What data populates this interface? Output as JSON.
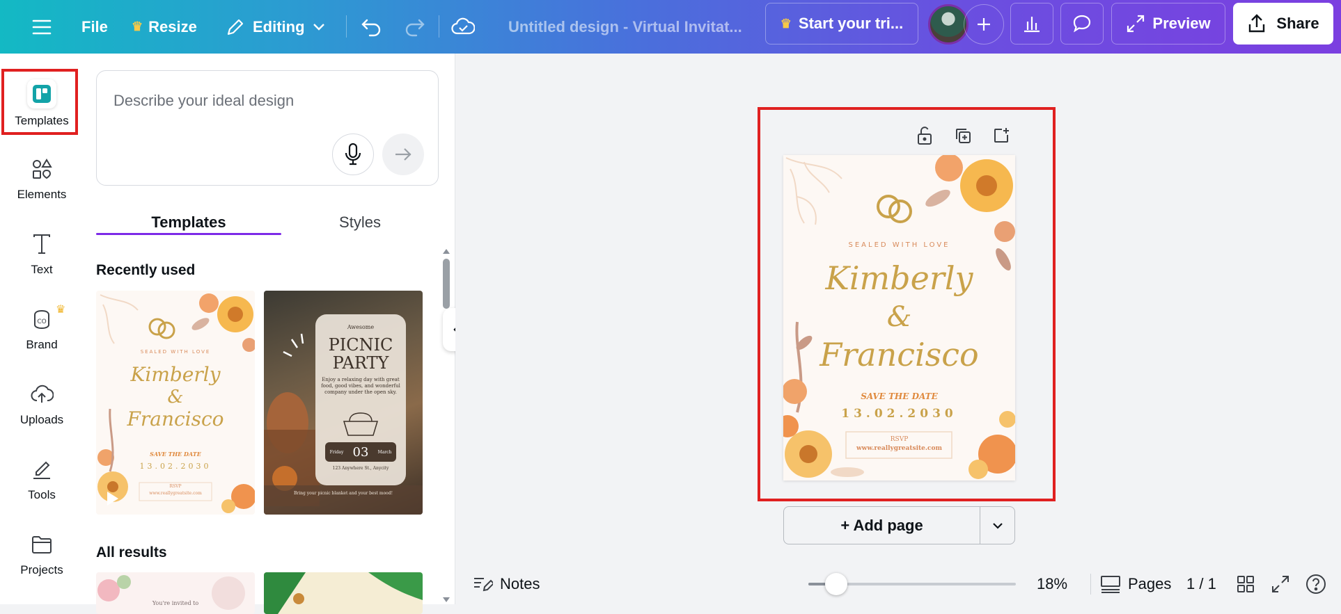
{
  "topbar": {
    "file_label": "File",
    "resize_label": "Resize",
    "editing_label": "Editing",
    "title": "Untitled design - Virtual Invitat...",
    "trial_label": "Start your tri...",
    "preview_label": "Preview",
    "share_label": "Share"
  },
  "rail": {
    "items": [
      {
        "label": "Templates",
        "icon": "templates-icon"
      },
      {
        "label": "Elements",
        "icon": "elements-icon"
      },
      {
        "label": "Text",
        "icon": "text-icon"
      },
      {
        "label": "Brand",
        "icon": "brand-icon"
      },
      {
        "label": "Uploads",
        "icon": "uploads-icon"
      },
      {
        "label": "Tools",
        "icon": "tools-icon"
      },
      {
        "label": "Projects",
        "icon": "projects-icon"
      }
    ]
  },
  "panel": {
    "prompt_placeholder": "Describe your ideal design",
    "tabs": [
      {
        "label": "Templates"
      },
      {
        "label": "Styles"
      }
    ],
    "recently_used_title": "Recently used",
    "all_results_title": "All results",
    "thumb1": {
      "subtitle": "SEALED WITH LOVE",
      "name1": "Kimberly",
      "amp": "&",
      "name2": "Francisco",
      "save": "SAVE THE DATE",
      "date": "13.02.2030",
      "rsvp": "RSVP",
      "site": "www.reallygreatsite.com"
    },
    "thumb2": {
      "kicker": "Awesome",
      "title1": "PICNIC",
      "title2": "PARTY",
      "body": "Enjoy a relaxing day with great food, good vibes, and wonderful company under the open sky.",
      "day": "Friday",
      "num": "03",
      "month": "March",
      "addr": "123 Anywhere St., Anycity",
      "footer": "Bring your picnic blanket and your best mood!"
    },
    "thumb3": {
      "text": "You're invited to"
    }
  },
  "design": {
    "subtitle": "SEALED WITH LOVE",
    "name1": "Kimberly",
    "amp": "&",
    "name2": "Francisco",
    "save": "SAVE THE DATE",
    "date": "13.02.2030",
    "rsvp": "RSVP",
    "site": "www.reallygreatsite.com"
  },
  "canvas": {
    "add_page_label": "+ Add page"
  },
  "bottombar": {
    "notes_label": "Notes",
    "zoom_level": "18%",
    "zoom_fraction": 0.18,
    "pages_label": "Pages",
    "page_counter": "1 / 1"
  },
  "colors": {
    "accent": "#7d2ae8",
    "highlight": "#e02020",
    "gold": "#c9a24a"
  }
}
